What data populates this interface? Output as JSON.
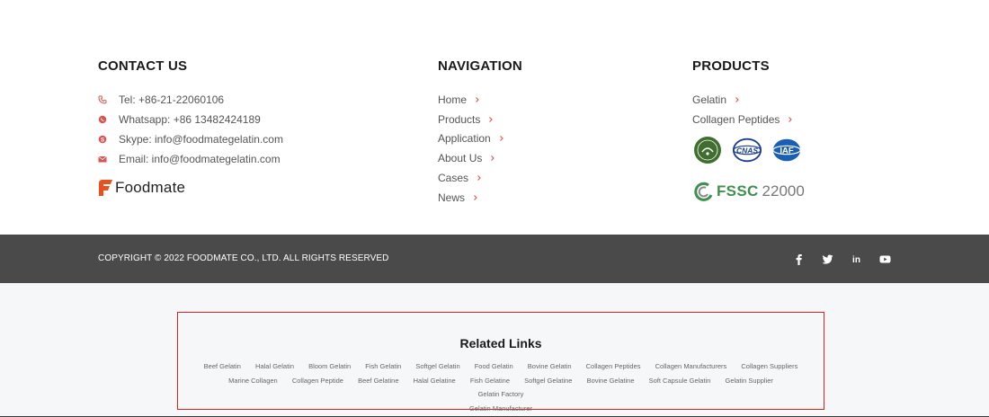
{
  "contact": {
    "title": "CONTACT US",
    "items": [
      {
        "icon": "phone-icon",
        "text": "Tel: +86-21-22060106"
      },
      {
        "icon": "whatsapp-icon",
        "text": "Whatsapp: +86 13482424189"
      },
      {
        "icon": "skype-icon",
        "text": "Skype: info@foodmategelatin.com"
      },
      {
        "icon": "email-icon",
        "text": "Email: info@foodmategelatin.com"
      }
    ],
    "logo_text": "Foodmate"
  },
  "navigation": {
    "title": "NAVIGATION",
    "items": [
      "Home",
      "Products",
      "Application",
      "About Us",
      "Cases",
      "News"
    ]
  },
  "products": {
    "title": "PRODUCTS",
    "items": [
      "Gelatin",
      "Collagen Peptides"
    ],
    "certs": [
      "halal-badge",
      "cnas-badge",
      "iaf-badge"
    ],
    "fssc_text": "FSSC",
    "fssc_number": "22000"
  },
  "copyright": {
    "text": "COPYRIGHT © 2022 FOODMATE CO., LTD. ALL RIGHTS RESERVED",
    "social": [
      "facebook-icon",
      "twitter-icon",
      "linkedin-icon",
      "youtube-icon"
    ]
  },
  "related": {
    "title": "Related Links",
    "links": [
      "Beef Gelatin",
      "Halal Gelatin",
      "Bloom Gelatin",
      "Fish Gelatin",
      "Softgel Gelatin",
      "Food Gelatin",
      "Bovine Gelatin",
      "Collagen Peptides",
      "Collagen Manufacturers",
      "Collagen Suppliers",
      "Marine Collagen",
      "Collagen Peptide",
      "Beef Gelatine",
      "Halal Gelatine",
      "Fish Gelatine",
      "Softgel Gelatine",
      "Bovine Gelatine",
      "Soft Capsule Gelatin",
      "Gelatin Supplier",
      "Gelatin Factory",
      "Gelatin Manufacturer"
    ]
  },
  "colors": {
    "accent": "#d9534f",
    "bar": "#4a4a4a",
    "related_border": "#e02020",
    "brand_orange": "#e8501e"
  }
}
